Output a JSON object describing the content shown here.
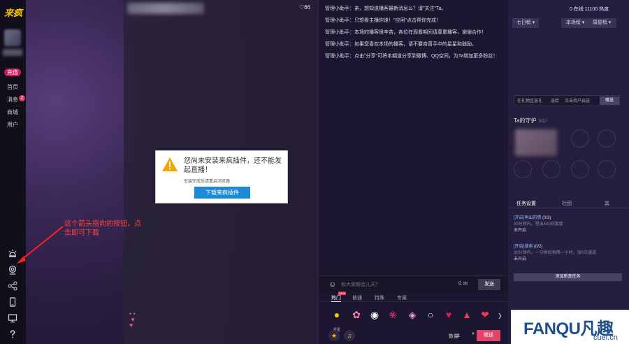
{
  "nav": {
    "logo": "来疯",
    "recharge": "充值",
    "items": [
      {
        "label": "首页"
      },
      {
        "label": "消息",
        "badge": "2"
      },
      {
        "label": "商城"
      },
      {
        "label": "用户"
      }
    ]
  },
  "video": {
    "likes": "♡66",
    "dialog": {
      "message": "您尚未安装来疯插件，还不能发起直播！",
      "sub": "安装完成后请重启浏览器",
      "button": "下载来疯插件"
    }
  },
  "annotation": {
    "text": "这个箭头指向的按钮，点击即可下载"
  },
  "chat": {
    "messages": [
      "管理小助手：亲，想知道播客最新消息么？请\"关注\"Ta。",
      "管理小助手：只想看主播你谁！\"应用\"点击帮你完成！",
      "管理小助手：本场的播客很辛苦，各位在观看期间请尊重播客，谢谢合作！",
      "管理小助手：如果您喜欢本场的播客，请不要吝啬手中的星星和鼓励。",
      "管理小助手：点击\"分享\"可将本期道分享到微博、QQ空间，为Ta增加更多粉丝！"
    ],
    "input_placeholder": "和大家聊会儿天？",
    "input_counter": "0",
    "send": "发送",
    "gift_tabs": [
      "热门",
      "普通",
      "特殊",
      "专属"
    ],
    "new_tag": "NEW",
    "gift_first_label": "星星",
    "quantity_label": "数量",
    "quantity": "1",
    "gift_send": "赠送"
  },
  "right": {
    "stats": "0 在线    11100 热度",
    "rank_tabs": [
      "七日榜",
      "本场榜",
      "周星榜"
    ],
    "guard_input": [
      "在礼物区送礼",
      "送给",
      "点击用户启送"
    ],
    "guard_button": "赠送",
    "guard_title": "Ta的守护",
    "guard_count": "3/12",
    "task_tabs": [
      "任务设置",
      "社团",
      "其"
    ],
    "tasks": [
      {
        "head": "[开启]再出的情",
        "count": "(0/3)",
        "sub": "30分钟内，星出500热度度",
        "status": "未开启"
      },
      {
        "head": "[开启]搜索",
        "count": "(0/2)",
        "sub": "30分钟内，一分钟后每隔一小时，加0次通道",
        "status": "未开启"
      }
    ],
    "add_task": "添加新宽任务"
  },
  "watermark": {
    "main": "FANQU凡趣",
    "sub": "cuel.cn"
  }
}
